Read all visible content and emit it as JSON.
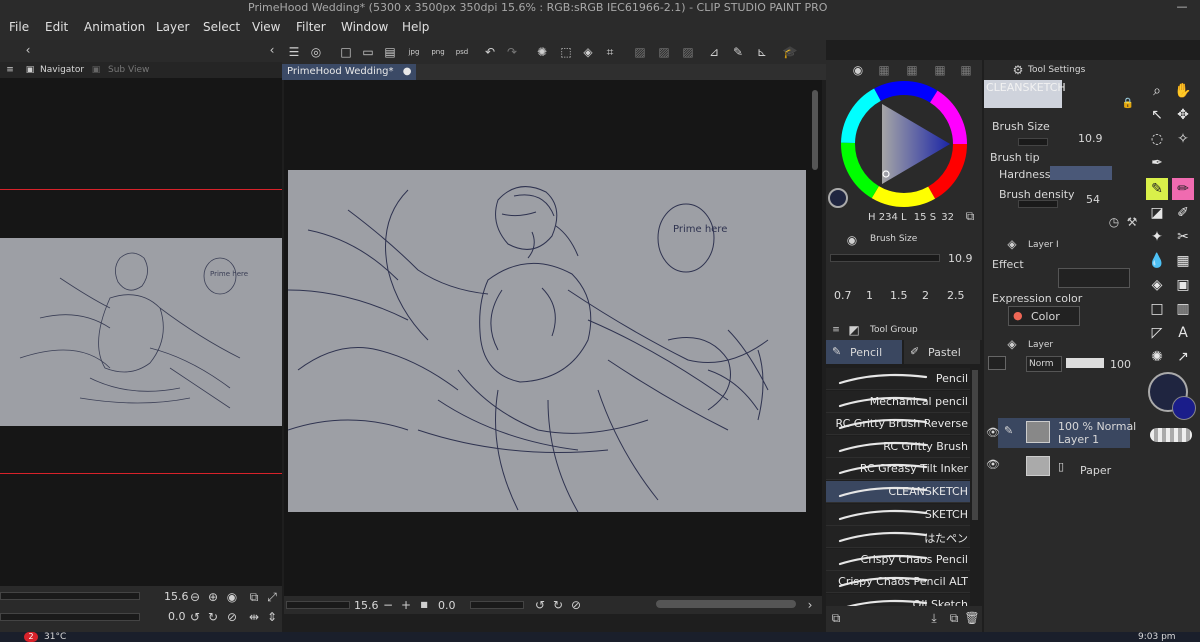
{
  "window": {
    "title": "PrimeHood Wedding* (5300 x 3500px 350dpi 15.6% : RGB:sRGB IEC61966-2.1) - CLIP STUDIO PAINT PRO",
    "minimize_glyph": "—"
  },
  "menu": [
    "File",
    "Edit",
    "Animation",
    "Layer",
    "Select",
    "View",
    "Filter",
    "Window",
    "Help"
  ],
  "left_panel": {
    "tab_navigator": "Navigator",
    "tab_subview": "Sub View",
    "zoom_value": "15.6",
    "rotate_value": "0.0"
  },
  "canvas": {
    "tab_label": "PrimeHood Wedding*",
    "sketch_text": "Prime here",
    "status_zoom": "15.6",
    "status_rotate": "0.0"
  },
  "color_panel": {
    "h_label": "H",
    "h_value": "234",
    "l_label": "L",
    "l_value": "15",
    "s_label": "S",
    "s_value": "32",
    "main_color": "#1f2540",
    "sub_color": "#1a1d8a"
  },
  "brush_size_panel": {
    "title": "Brush Size",
    "value": "10.9",
    "presets": [
      "0.7",
      "1",
      "1.5",
      "2",
      "2.5"
    ]
  },
  "tool_group": {
    "title": "Tool Group",
    "tab_pencil": "Pencil",
    "tab_pastel": "Pastel",
    "brushes": [
      {
        "name": "Pencil",
        "selected": false
      },
      {
        "name": "Mechanical pencil",
        "selected": false
      },
      {
        "name": "RC Gritty Brush Reverse",
        "selected": false
      },
      {
        "name": "RC Gritty Brush",
        "selected": false
      },
      {
        "name": "RC Greasy Tilt Inker",
        "selected": false
      },
      {
        "name": "CLEANSKETCH",
        "selected": true
      },
      {
        "name": "SKETCH",
        "selected": false
      },
      {
        "name": "はたペン",
        "selected": false
      },
      {
        "name": "Crispy Chaos Pencil",
        "selected": false
      },
      {
        "name": "Crispy Chaos Pencil ALT",
        "selected": false
      },
      {
        "name": "Oil Sketch",
        "selected": false
      }
    ]
  },
  "tool_settings": {
    "tab": "Tool Settings",
    "sub_tool_name": "CLEANSKETCH",
    "brush_size_label": "Brush Size",
    "brush_size_value": "10.9",
    "brush_tip_label": "Brush tip",
    "hardness_label": "Hardness",
    "density_label": "Brush density",
    "density_value": "54"
  },
  "layer_property": {
    "tab": "Layer I",
    "effect_label": "Effect",
    "expression_label": "Expression color",
    "expression_value": "Color"
  },
  "layer_panel": {
    "tab": "Layer",
    "blend_mode": "Norm",
    "opacity": "100",
    "layers": [
      {
        "line1": "100 % Normal",
        "line2": "Layer 1"
      },
      {
        "line1": "Paper",
        "line2": ""
      }
    ]
  },
  "taskbar": {
    "temperature": "31°C",
    "clock": "9:03 pm",
    "badge": "2"
  },
  "toolbar_icons": [
    "menu-icon",
    "csp-logo-icon",
    "new-icon",
    "open-icon",
    "save-icon",
    "export-jpg-icon",
    "export-png-icon",
    "export-psd-icon",
    "undo-icon",
    "redo-icon"
  ]
}
